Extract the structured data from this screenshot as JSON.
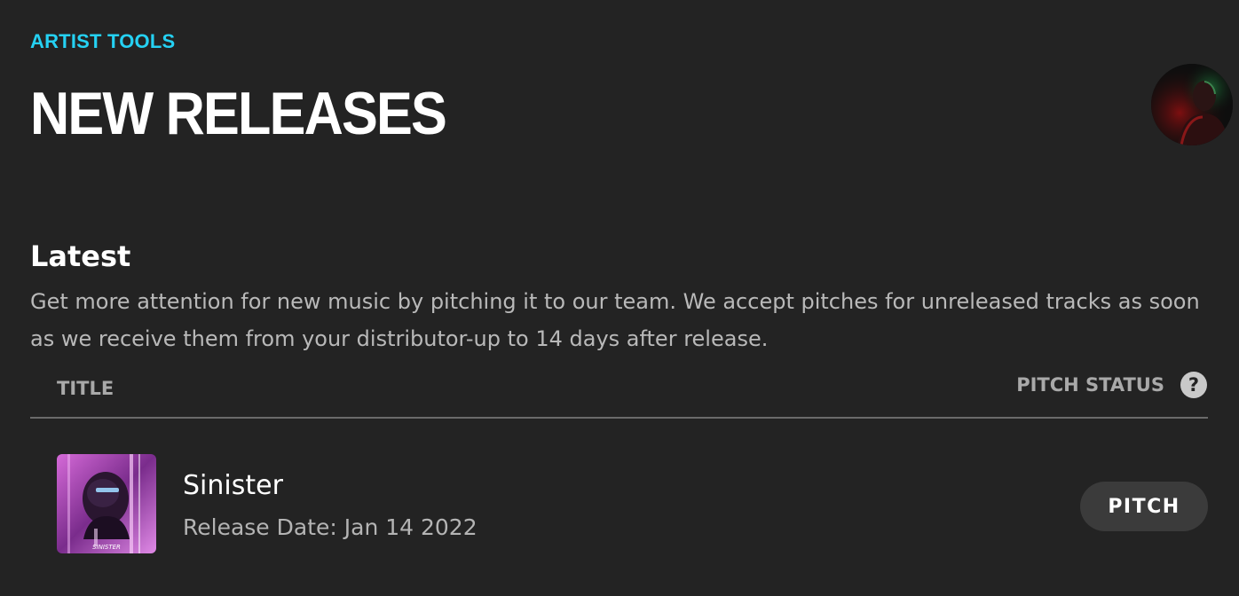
{
  "header": {
    "eyebrow": "ARTIST TOOLS",
    "title": "NEW RELEASES"
  },
  "latest": {
    "title": "Latest",
    "description": "Get more attention for new music by pitching it to our team. We accept pitches for unreleased tracks as soon as we receive them from your distributor-up to 14 days after release."
  },
  "table": {
    "columns": {
      "title": "TITLE",
      "pitch_status": "PITCH STATUS"
    },
    "help_icon_glyph": "?",
    "rows": [
      {
        "title": "Sinister",
        "release_date": "Release Date: Jan 14 2022",
        "art_text": "SINISTER",
        "action_label": "PITCH"
      }
    ]
  },
  "colors": {
    "background": "#232323",
    "accent": "#25d1f3",
    "button_bg": "#3b3b3b"
  },
  "icons": {
    "avatar": "user-avatar",
    "help": "help-icon",
    "album_art": "album-art"
  }
}
